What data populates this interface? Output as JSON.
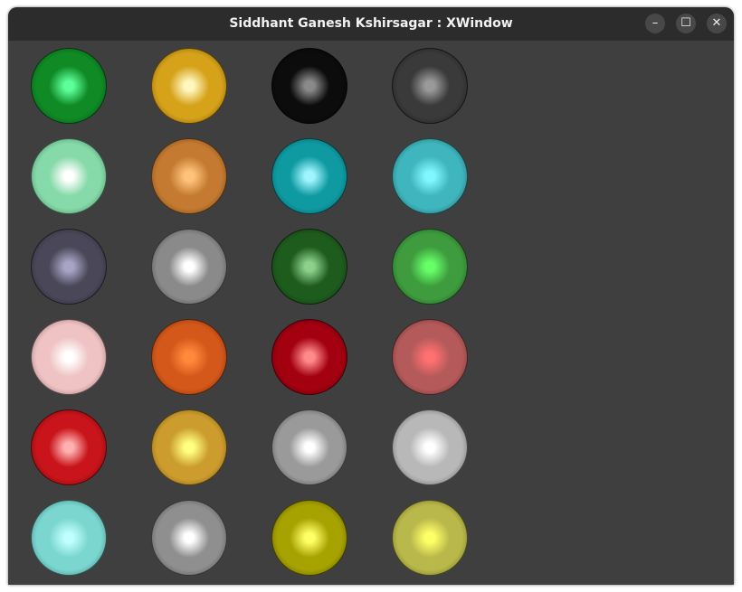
{
  "window": {
    "title": "Siddhant Ganesh Kshirsagar : XWindow",
    "controls": {
      "minimize_glyph": "–",
      "maximize_glyph": "☐",
      "close_glyph": "✕"
    },
    "background_color": "#3f3f3f"
  },
  "spheres": {
    "columns": 4,
    "rows": 6,
    "items": [
      {
        "highlight": "#5cff9a",
        "base": "#0f8a25",
        "rim": "#033d0c"
      },
      {
        "highlight": "#fff7c0",
        "base": "#d6a21a",
        "rim": "#5c3f05"
      },
      {
        "highlight": "#8a8a8a",
        "base": "#0c0c0c",
        "rim": "#000000"
      },
      {
        "highlight": "#9a9a9a",
        "base": "#3a3a3a",
        "rim": "#111111"
      },
      {
        "highlight": "#ffffff",
        "base": "#86d9a8",
        "rim": "#2f6a45"
      },
      {
        "highlight": "#ffc27a",
        "base": "#c47a30",
        "rim": "#5a3310"
      },
      {
        "highlight": "#9ff5ff",
        "base": "#0f9aa2",
        "rim": "#03494d"
      },
      {
        "highlight": "#7ff7ff",
        "base": "#3fb6bd",
        "rim": "#173f42"
      },
      {
        "highlight": "#a7a4c6",
        "base": "#4a4858",
        "rim": "#1c1b24"
      },
      {
        "highlight": "#ffffff",
        "base": "#8a8a8a",
        "rim": "#2f2f2f"
      },
      {
        "highlight": "#8cd08c",
        "base": "#1e5c1e",
        "rim": "#082408"
      },
      {
        "highlight": "#66ff66",
        "base": "#3e9c3e",
        "rim": "#173d17"
      },
      {
        "highlight": "#ffffff",
        "base": "#efc3c3",
        "rim": "#6e4d4d"
      },
      {
        "highlight": "#ff8a3c",
        "base": "#d4581a",
        "rim": "#5e2206"
      },
      {
        "highlight": "#ff8a8a",
        "base": "#a30010",
        "rim": "#3a0005"
      },
      {
        "highlight": "#ff7070",
        "base": "#b55a5a",
        "rim": "#4d2222"
      },
      {
        "highlight": "#ffb0b0",
        "base": "#c8141a",
        "rim": "#4d0407"
      },
      {
        "highlight": "#ffff80",
        "base": "#cc9d2e",
        "rim": "#5e430b"
      },
      {
        "highlight": "#ffffff",
        "base": "#9a9a9a",
        "rim": "#2c2c2c"
      },
      {
        "highlight": "#ffffff",
        "base": "#b8b8b8",
        "rim": "#3a3a3a"
      },
      {
        "highlight": "#bfffff",
        "base": "#7ad6cf",
        "rim": "#2e5f5b"
      },
      {
        "highlight": "#ffffff",
        "base": "#8f8f8f",
        "rim": "#333333"
      },
      {
        "highlight": "#ffff66",
        "base": "#a6a200",
        "rim": "#3f3d00"
      },
      {
        "highlight": "#ffff66",
        "base": "#b9b84a",
        "rim": "#4a4a1c"
      }
    ]
  }
}
